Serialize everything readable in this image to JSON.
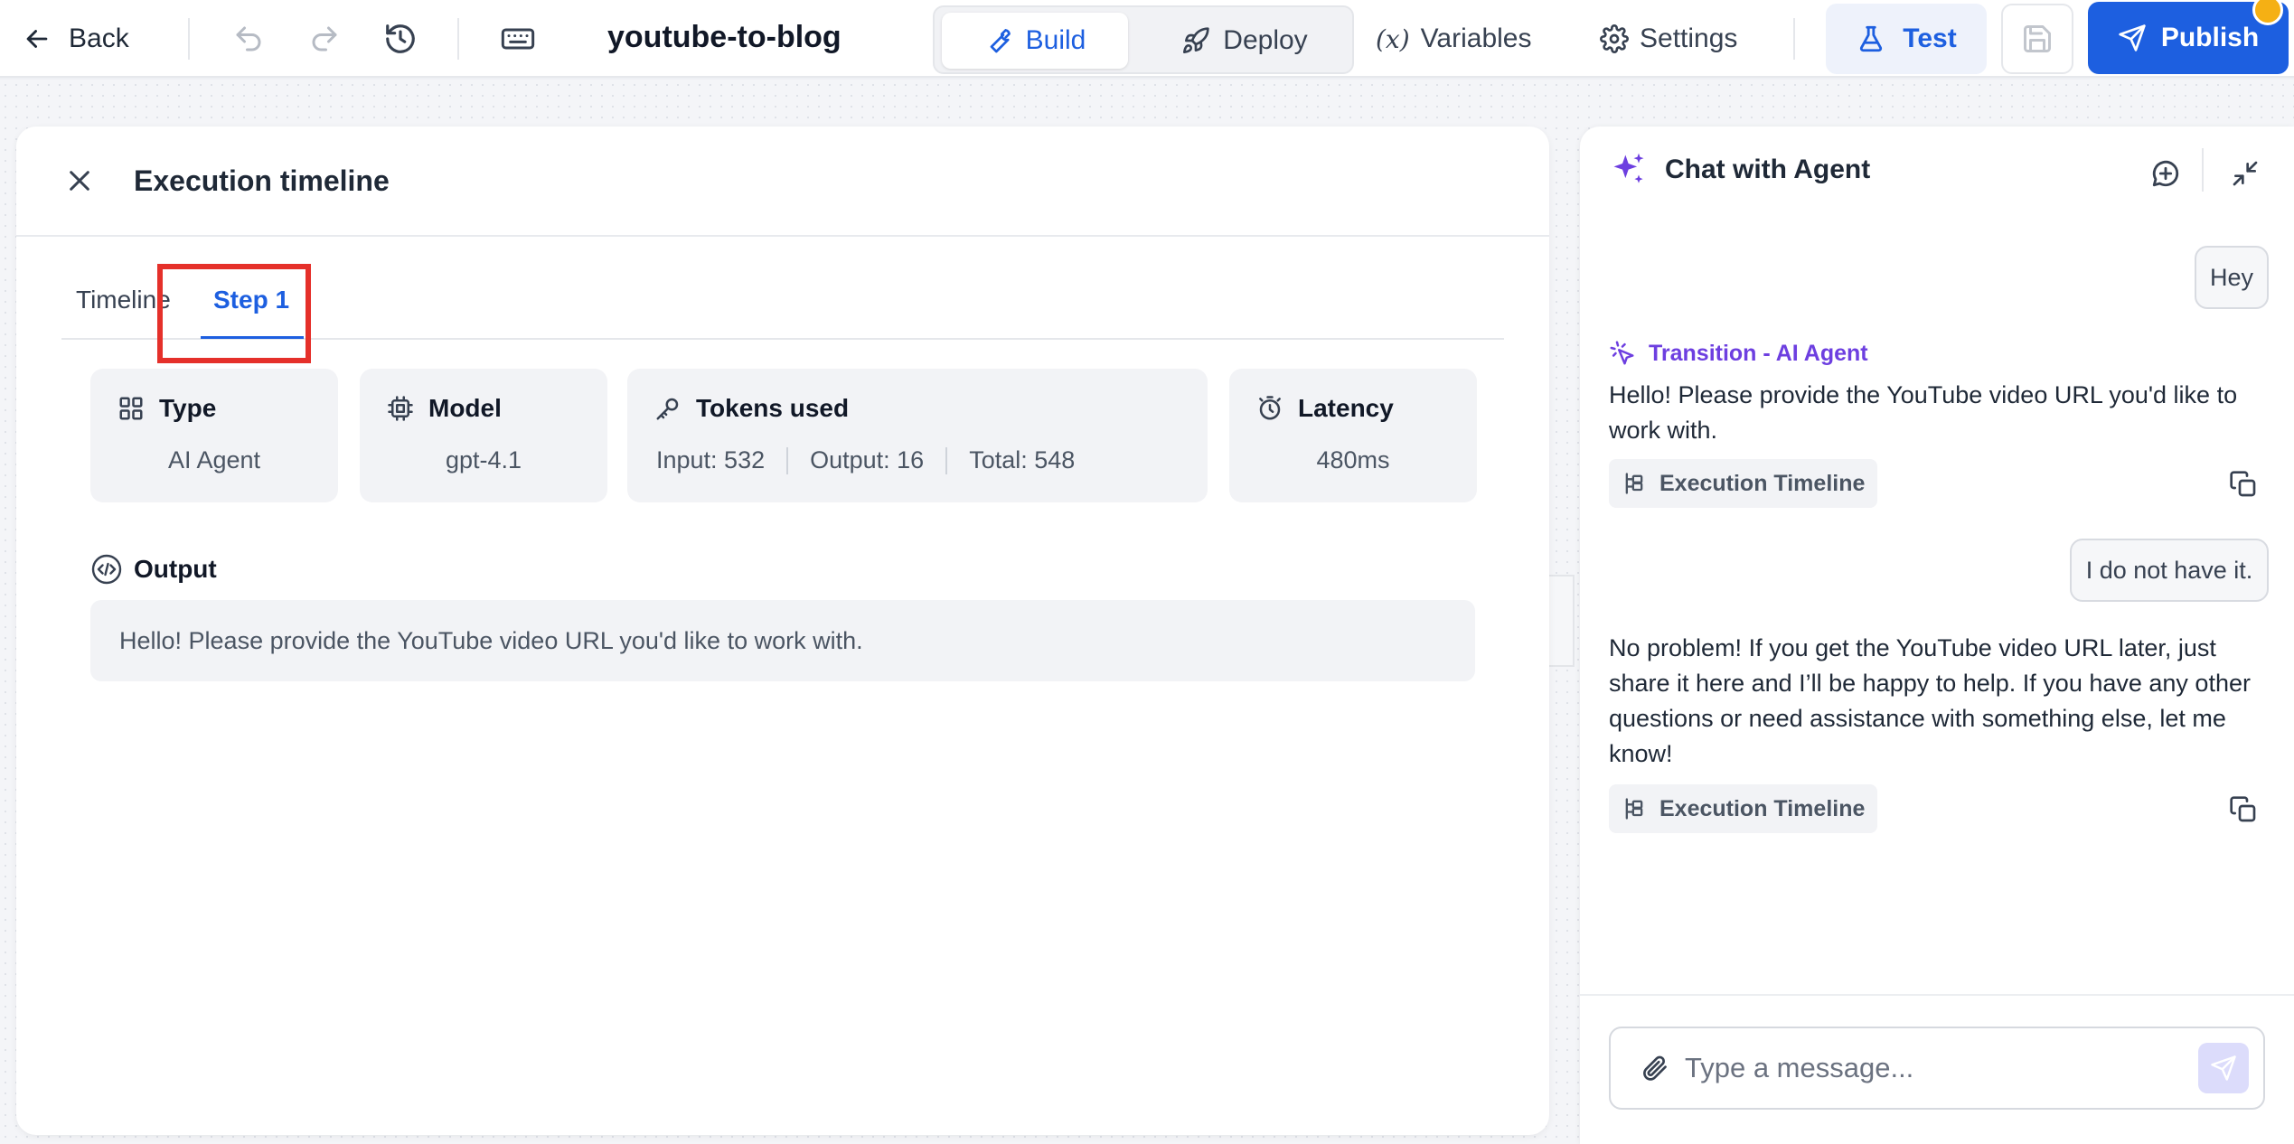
{
  "topbar": {
    "back_label": "Back",
    "project_title": "youtube-to-blog",
    "build_label": "Build",
    "deploy_label": "Deploy",
    "variables_label": "Variables",
    "variables_icon": "(x)",
    "settings_label": "Settings",
    "test_label": "Test",
    "publish_label": "Publish"
  },
  "execution_panel": {
    "title": "Execution timeline",
    "tabs": [
      {
        "label": "Timeline",
        "active": false
      },
      {
        "label": "Step 1",
        "active": true
      }
    ],
    "cards": {
      "type": {
        "label": "Type",
        "value": "AI Agent"
      },
      "model": {
        "label": "Model",
        "value": "gpt-4.1"
      },
      "tokens": {
        "label": "Tokens used",
        "input": "Input: 532",
        "output": "Output: 16",
        "total": "Total: 548"
      },
      "latency": {
        "label": "Latency",
        "value": "480ms"
      }
    },
    "output": {
      "label": "Output",
      "text": "Hello! Please provide the YouTube video URL you'd like to work with."
    }
  },
  "chat": {
    "title": "Chat with Agent",
    "messages": [
      {
        "role": "user",
        "text": "Hey"
      },
      {
        "role": "agent",
        "transition": "Transition - AI Agent",
        "text": "Hello! Please provide the YouTube video URL you'd like to work with.",
        "chip": "Execution Timeline"
      },
      {
        "role": "user",
        "text": "I do not have it."
      },
      {
        "role": "agent",
        "text": "No problem! If you get the YouTube video URL later, just share it here and I’ll be happy to help. If you have any other questions or need assistance with something else, let me know!",
        "chip": "Execution Timeline"
      }
    ],
    "input_placeholder": "Type a message..."
  },
  "colors": {
    "accent": "#1d5fe0",
    "transition": "#6d3fe0",
    "highlight": "#e5302a",
    "notification": "#f5b014"
  },
  "icons": {
    "back": "arrow-left-icon",
    "undo": "undo-icon",
    "redo": "redo-icon",
    "history": "history-icon",
    "keyboard": "keyboard-icon",
    "build": "wrench-icon",
    "deploy": "rocket-icon",
    "settings": "gear-icon",
    "test": "flask-icon",
    "save": "save-icon",
    "publish": "send-icon",
    "close": "close-icon",
    "type": "grid-icon",
    "model": "chip-icon",
    "tokens": "key-icon",
    "latency": "timer-icon",
    "output": "code-icon",
    "chat": "sparkles-icon",
    "new_chat": "chat-plus-icon",
    "collapse": "collapse-icon",
    "copy": "copy-icon",
    "execution": "tree-icon",
    "attach": "paperclip-icon",
    "send": "send-icon"
  }
}
